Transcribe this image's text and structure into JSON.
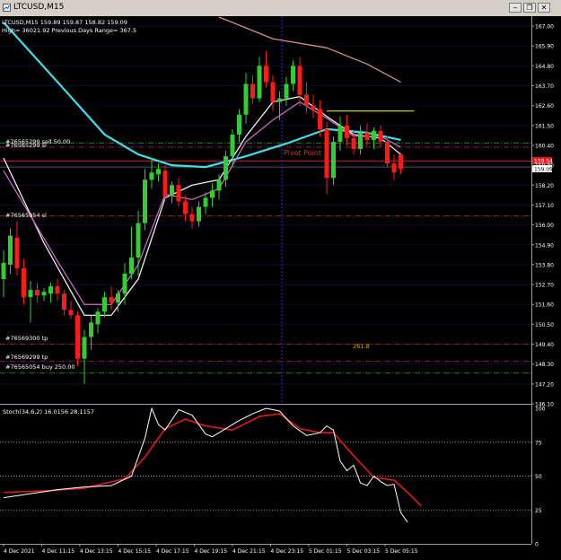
{
  "window": {
    "title": "LTCUSD,M15",
    "minimize_glyph": "‒",
    "restore_glyph": "❐",
    "close_glyph": "✕"
  },
  "main_chart": {
    "ohlc_label": "LTCUSD,M15  159.89 159.87 158.82 159.09",
    "info_label": "High= 36021.92   Previous Days Range= 367.5",
    "price_axis": [
      "167.00",
      "165.90",
      "164.80",
      "163.70",
      "162.60",
      "161.50",
      "160.40",
      "159.30",
      "158.20",
      "157.10",
      "156.00",
      "154.90",
      "153.80",
      "152.70",
      "151.60",
      "150.50",
      "149.40",
      "148.30",
      "147.20",
      "146.10"
    ],
    "current_price_label": "159.09",
    "red_price_label": "159.54",
    "pivot_label": "Pivot Point",
    "fib_label": "261.8",
    "order_labels": {
      "sell": "#76565299 sell 50.00",
      "sl_a": "#76565299 sl",
      "sl_b": "#76565054 sl",
      "tp_a": "#76569300 tp",
      "tp_b": "#76569299 tp",
      "buy": "#76565054 buy 250.00"
    }
  },
  "stoch_panel": {
    "label": "Stoch(34,6,2) 16.0156 28.1157",
    "axis": [
      "100",
      "75",
      "50",
      "25",
      "0"
    ]
  },
  "x_axis": [
    "4 Dec 2021",
    "4 Dec 11:15",
    "4 Dec 13:15",
    "4 Dec 15:15",
    "4 Dec 17:15",
    "4 Dec 19:15",
    "4 Dec 21:15",
    "4 Dec 23:15",
    "5 Dec 01:15",
    "5 Dec 03:15",
    "5 Dec 05:15"
  ],
  "colors": {
    "bull": "#32cd32",
    "bear": "#ff1a1a",
    "ma_cyan": "#40e0e8",
    "ma_salmon": "#e8a08a",
    "ma_white": "#ffffff",
    "ma_violet": "#d070d0",
    "stoch_main": "#ffffff",
    "stoch_signal": "#e01a1a"
  },
  "chart_data": {
    "type": "candlestick",
    "symbol": "LTCUSD",
    "timeframe": "M15",
    "ylim": [
      146.1,
      167.55
    ],
    "candles": [
      [
        153.0,
        154.6,
        152.0,
        153.9
      ],
      [
        153.8,
        155.8,
        153.3,
        155.4
      ],
      [
        155.3,
        156.2,
        153.2,
        153.6
      ],
      [
        153.6,
        154.1,
        151.6,
        152.0
      ],
      [
        152.0,
        152.9,
        150.6,
        152.4
      ],
      [
        152.4,
        152.8,
        151.7,
        152.1
      ],
      [
        152.1,
        152.5,
        151.8,
        152.3
      ],
      [
        152.2,
        152.8,
        151.7,
        152.6
      ],
      [
        152.6,
        153.0,
        151.8,
        152.2
      ],
      [
        152.2,
        152.4,
        151.0,
        151.3
      ],
      [
        151.3,
        151.8,
        150.8,
        151.0
      ],
      [
        151.0,
        151.2,
        148.2,
        148.6
      ],
      [
        148.6,
        150.2,
        147.2,
        149.8
      ],
      [
        149.8,
        151.0,
        149.1,
        150.6
      ],
      [
        150.5,
        151.4,
        150.0,
        151.2
      ],
      [
        151.2,
        152.3,
        150.9,
        152.0
      ],
      [
        152.0,
        152.6,
        151.3,
        151.7
      ],
      [
        151.7,
        152.4,
        151.2,
        152.2
      ],
      [
        152.2,
        153.9,
        151.6,
        153.3
      ],
      [
        153.3,
        155.9,
        153.0,
        154.2
      ],
      [
        154.2,
        156.8,
        153.2,
        156.1
      ],
      [
        156.1,
        159.1,
        155.7,
        158.5
      ],
      [
        158.5,
        159.7,
        158.0,
        158.9
      ],
      [
        158.8,
        159.4,
        158.4,
        159.1
      ],
      [
        159.0,
        159.3,
        157.4,
        157.6
      ],
      [
        157.6,
        158.4,
        157.2,
        158.2
      ],
      [
        158.2,
        158.6,
        157.0,
        157.3
      ],
      [
        157.3,
        157.6,
        156.2,
        156.6
      ],
      [
        156.6,
        157.0,
        155.8,
        156.2
      ],
      [
        156.2,
        157.3,
        155.9,
        157.0
      ],
      [
        157.0,
        157.8,
        156.6,
        157.5
      ],
      [
        157.5,
        158.3,
        157.0,
        157.9
      ],
      [
        157.9,
        158.8,
        157.4,
        158.5
      ],
      [
        158.5,
        160.1,
        158.1,
        159.8
      ],
      [
        159.8,
        161.3,
        159.2,
        161.0
      ],
      [
        161.0,
        162.4,
        160.6,
        162.1
      ],
      [
        162.1,
        164.4,
        161.6,
        163.8
      ],
      [
        163.8,
        164.3,
        162.7,
        163.0
      ],
      [
        163.0,
        165.3,
        162.8,
        164.8
      ],
      [
        164.8,
        165.6,
        163.6,
        163.9
      ],
      [
        163.9,
        164.3,
        162.3,
        162.8
      ],
      [
        162.8,
        163.4,
        161.8,
        163.0
      ],
      [
        163.0,
        164.2,
        162.6,
        163.8
      ],
      [
        163.8,
        165.1,
        163.4,
        164.8
      ],
      [
        164.8,
        165.3,
        162.6,
        163.2
      ],
      [
        163.2,
        163.9,
        162.2,
        162.6
      ],
      [
        162.6,
        163.2,
        161.9,
        162.4
      ],
      [
        162.4,
        162.9,
        160.9,
        161.3
      ],
      [
        161.3,
        161.7,
        157.7,
        158.6
      ],
      [
        158.6,
        160.9,
        158.2,
        160.6
      ],
      [
        160.6,
        162.0,
        160.1,
        161.5
      ],
      [
        161.5,
        162.1,
        160.4,
        160.8
      ],
      [
        160.8,
        161.2,
        159.9,
        160.2
      ],
      [
        160.2,
        161.5,
        159.9,
        161.1
      ],
      [
        161.1,
        161.6,
        160.4,
        160.7
      ],
      [
        160.7,
        161.4,
        160.2,
        161.2
      ],
      [
        161.2,
        161.5,
        160.3,
        160.6
      ],
      [
        160.6,
        160.9,
        159.2,
        159.4
      ],
      [
        159.4,
        159.9,
        158.5,
        158.9
      ],
      [
        159.89,
        159.87,
        158.82,
        159.09
      ]
    ],
    "moving_averages": [
      {
        "color": "#40e0e8",
        "values": [
          [
            0,
            167.2
          ],
          [
            9,
            163.5
          ],
          [
            15,
            161.0
          ],
          [
            20,
            159.9
          ],
          [
            25,
            159.3
          ],
          [
            30,
            159.2
          ],
          [
            36,
            159.8
          ],
          [
            42,
            160.5
          ],
          [
            48,
            161.3
          ],
          [
            54,
            161.1
          ],
          [
            59,
            160.7
          ]
        ]
      },
      {
        "color": "#e8a08a",
        "values": [
          [
            32,
            167.5
          ],
          [
            40,
            166.3
          ],
          [
            48,
            165.8
          ],
          [
            54,
            164.9
          ],
          [
            59,
            163.9
          ]
        ]
      },
      {
        "color": "#ffffff",
        "values": [
          [
            0,
            159.7
          ],
          [
            6,
            155.0
          ],
          [
            12,
            151.0
          ],
          [
            16,
            151.0
          ],
          [
            20,
            153.0
          ],
          [
            24,
            157.5
          ],
          [
            28,
            158.2
          ],
          [
            32,
            158.5
          ],
          [
            36,
            160.9
          ],
          [
            40,
            162.8
          ],
          [
            44,
            163.1
          ],
          [
            48,
            162.0
          ],
          [
            52,
            161.0
          ],
          [
            56,
            160.8
          ],
          [
            59,
            159.9
          ]
        ]
      },
      {
        "color": "#d070d0",
        "values": [
          [
            0,
            159.0
          ],
          [
            8,
            154.0
          ],
          [
            12,
            151.6
          ],
          [
            16,
            151.6
          ],
          [
            20,
            153.8
          ],
          [
            24,
            157.7
          ],
          [
            28,
            157.4
          ],
          [
            32,
            158.0
          ],
          [
            36,
            160.6
          ],
          [
            40,
            161.8
          ],
          [
            44,
            162.8
          ],
          [
            48,
            161.9
          ],
          [
            52,
            160.9
          ],
          [
            56,
            160.9
          ],
          [
            59,
            160.3
          ]
        ]
      }
    ],
    "horizontal_lines": [
      {
        "price": 162.3,
        "color": "#ffff00",
        "style": "solid"
      },
      {
        "price": 160.53,
        "color": "#208020",
        "style": "dashdot"
      },
      {
        "price": 160.3,
        "color": "#8a2222",
        "style": "dashdot"
      },
      {
        "price": 159.54,
        "color": "#c82020",
        "style": "solid"
      },
      {
        "price": 159.2,
        "color": "#505050",
        "style": "solid"
      },
      {
        "price": 156.5,
        "color": "#8a2222",
        "style": "dashdot"
      },
      {
        "price": 149.4,
        "color": "#8a2222",
        "style": "dashdot"
      },
      {
        "price": 148.45,
        "color": "#8a2222",
        "style": "dashdot"
      },
      {
        "price": 147.8,
        "color": "#208020",
        "style": "dashdot"
      }
    ],
    "stochastic": {
      "main": [
        [
          0,
          34
        ],
        [
          4,
          37
        ],
        [
          8,
          40
        ],
        [
          12,
          42
        ],
        [
          16,
          43
        ],
        [
          19,
          50
        ],
        [
          21,
          78
        ],
        [
          22,
          100
        ],
        [
          23,
          88
        ],
        [
          24,
          84
        ],
        [
          26,
          99
        ],
        [
          28,
          95
        ],
        [
          30,
          81
        ],
        [
          31,
          79
        ],
        [
          32,
          82
        ],
        [
          33,
          85
        ],
        [
          35,
          91
        ],
        [
          37,
          96
        ],
        [
          39,
          100
        ],
        [
          41,
          98
        ],
        [
          43,
          87
        ],
        [
          45,
          80
        ],
        [
          47,
          82
        ],
        [
          48,
          87
        ],
        [
          49,
          84
        ],
        [
          50,
          61
        ],
        [
          51,
          54
        ],
        [
          52,
          58
        ],
        [
          53,
          45
        ],
        [
          54,
          43
        ],
        [
          55,
          50
        ],
        [
          56,
          46
        ],
        [
          57,
          43
        ],
        [
          58,
          44
        ],
        [
          59,
          23
        ],
        [
          60,
          16
        ]
      ],
      "signal": [
        [
          0,
          38
        ],
        [
          6,
          39
        ],
        [
          12,
          41
        ],
        [
          18,
          48
        ],
        [
          21,
          64
        ],
        [
          24,
          85
        ],
        [
          27,
          92
        ],
        [
          30,
          87
        ],
        [
          34,
          84
        ],
        [
          38,
          94
        ],
        [
          41,
          96
        ],
        [
          44,
          85
        ],
        [
          47,
          82
        ],
        [
          49,
          82
        ],
        [
          52,
          65
        ],
        [
          55,
          49
        ],
        [
          58,
          47
        ],
        [
          60,
          38
        ],
        [
          62,
          28
        ]
      ],
      "levels": [
        75,
        50,
        25
      ],
      "ylim": [
        0,
        100
      ]
    }
  }
}
